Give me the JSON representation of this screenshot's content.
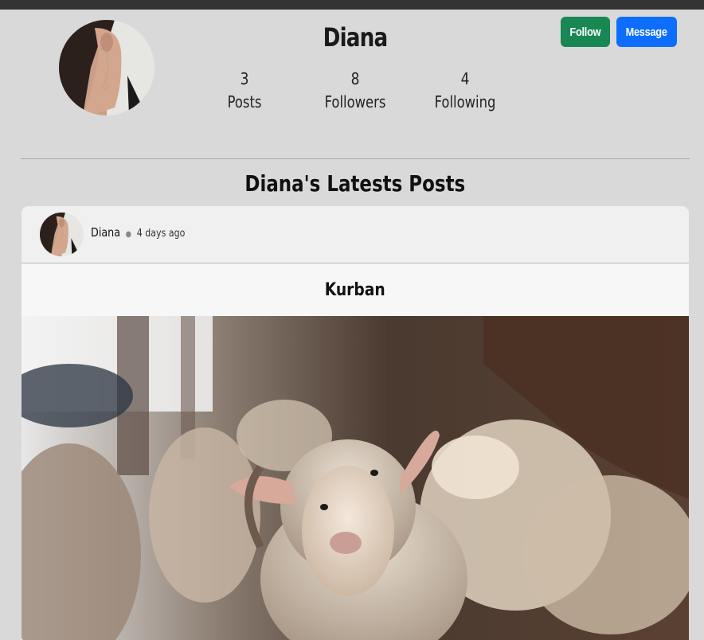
{
  "profile": {
    "name": "Diana",
    "avatar_icon": "woman-profile-photo",
    "stats": [
      {
        "value": "3",
        "label": "Posts"
      },
      {
        "value": "8",
        "label": "Followers"
      },
      {
        "value": "4",
        "label": "Following"
      }
    ],
    "follow_label": "Follow",
    "message_label": "Message",
    "colors": {
      "follow": "#198754",
      "message": "#0d6efd"
    }
  },
  "posts_section": {
    "title": "Diana's Latests Posts"
  },
  "post": {
    "author": "Diana",
    "separator": "●",
    "time": "4 days ago",
    "title": "Kurban",
    "image_icon": "sheep-photo"
  }
}
